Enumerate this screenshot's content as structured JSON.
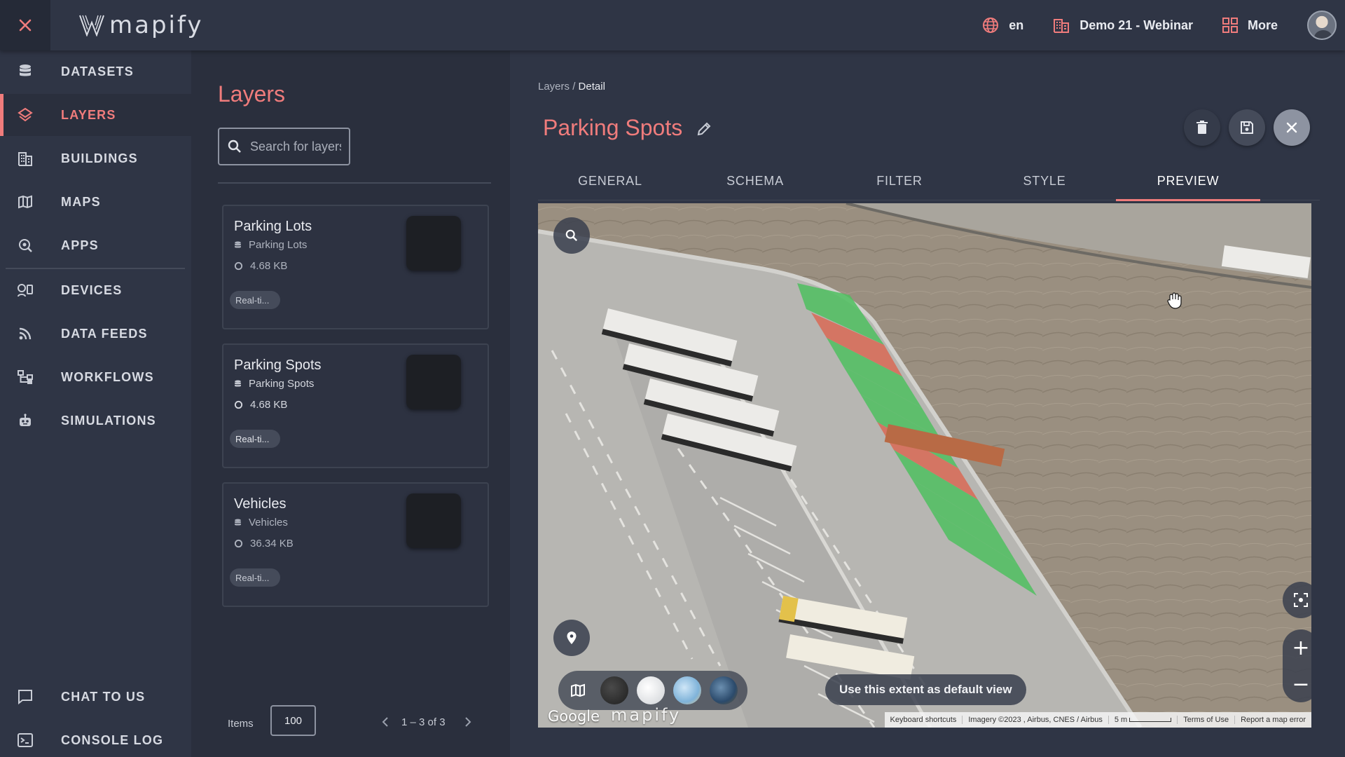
{
  "app": {
    "logo_text": "mapify"
  },
  "topbar": {
    "language": "en",
    "org": "Demo 21 - Webinar",
    "more": "More"
  },
  "sidebar": {
    "items": [
      {
        "label": "DATASETS",
        "icon": "database-icon"
      },
      {
        "label": "LAYERS",
        "icon": "layers-icon",
        "active": true
      },
      {
        "label": "BUILDINGS",
        "icon": "buildings-icon"
      },
      {
        "label": "MAPS",
        "icon": "map-icon"
      },
      {
        "label": "APPS",
        "icon": "apps-search-icon"
      },
      {
        "label": "DEVICES",
        "icon": "devices-icon"
      },
      {
        "label": "DATA FEEDS",
        "icon": "rss-icon"
      },
      {
        "label": "WORKFLOWS",
        "icon": "workflow-icon"
      },
      {
        "label": "SIMULATIONS",
        "icon": "robot-icon"
      }
    ],
    "bottom": [
      {
        "label": "CHAT TO US",
        "icon": "chat-icon"
      },
      {
        "label": "CONSOLE LOG",
        "icon": "terminal-icon"
      }
    ]
  },
  "layers": {
    "title": "Layers",
    "search_placeholder": "Search for layers",
    "cards": [
      {
        "title": "Parking Lots",
        "dataset": "Parking Lots",
        "size": "4.68 KB",
        "tag": "Real-ti..."
      },
      {
        "title": "Parking Spots",
        "dataset": "Parking Spots",
        "size": "4.68 KB",
        "tag": "Real-ti..."
      },
      {
        "title": "Vehicles",
        "dataset": "Vehicles",
        "size": "36.34 KB",
        "tag": "Real-ti..."
      }
    ],
    "pager": {
      "items_label": "Items",
      "items_value": "100",
      "range": "1 – 3 of 3"
    }
  },
  "detail": {
    "breadcrumb_root": "Layers",
    "breadcrumb_sep": " / ",
    "breadcrumb_current": "Detail",
    "title": "Parking Spots",
    "tabs": [
      "GENERAL",
      "SCHEMA",
      "FILTER",
      "STYLE",
      "PREVIEW"
    ],
    "active_tab": "PREVIEW",
    "accent_color": "#f07c7c"
  },
  "map": {
    "default_view_label": "Use this extent as default view",
    "google": "Google",
    "brand": "mapify",
    "attribution": {
      "shortcuts": "Keyboard shortcuts",
      "imagery": "Imagery ©2023 , Airbus, CNES / Airbus",
      "scale": "5 m",
      "terms": "Terms of Use",
      "report": "Report a map error"
    },
    "spot_colors": {
      "free": "#4fbf5f",
      "occupied": "#d96a55"
    }
  }
}
